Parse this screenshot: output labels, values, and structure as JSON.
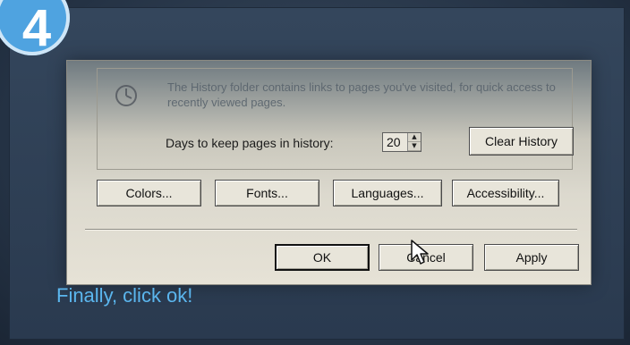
{
  "step_badge": "4",
  "dialog": {
    "history": {
      "description": "The History folder contains links to pages you've visited, for quick access to recently viewed pages.",
      "days_label": "Days to keep pages in history:",
      "days_value": "20",
      "clear_button": "Clear History"
    },
    "buttons": {
      "colors": "Colors...",
      "fonts": "Fonts...",
      "languages": "Languages...",
      "accessibility": "Accessibility..."
    },
    "footer": {
      "ok": "OK",
      "cancel": "Cancel",
      "apply": "Apply"
    }
  },
  "caption": "Finally, click ok!",
  "colors": {
    "badge": "#4fa3e0",
    "caption": "#5bb6ee"
  }
}
